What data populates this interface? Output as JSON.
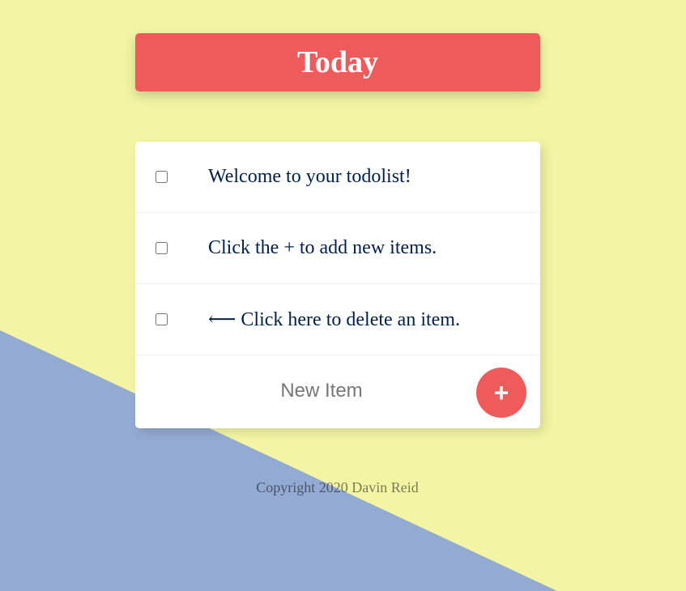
{
  "colors": {
    "background_yellow": "#f3f5a4",
    "background_blue": "#93aad2",
    "accent_red": "#ef5b5b",
    "text_navy": "#00204a"
  },
  "heading": {
    "title": "Today"
  },
  "items": [
    {
      "text": "Welcome to your todolist!",
      "checked": false
    },
    {
      "text": "Click the + to add new items.",
      "checked": false
    },
    {
      "text": "⟵ Click here to delete an item.",
      "checked": false
    }
  ],
  "new_item": {
    "placeholder": "New Item",
    "value": ""
  },
  "add_button": {
    "label": "+"
  },
  "footer": {
    "text": "Copyright 2020 Davin Reid"
  }
}
